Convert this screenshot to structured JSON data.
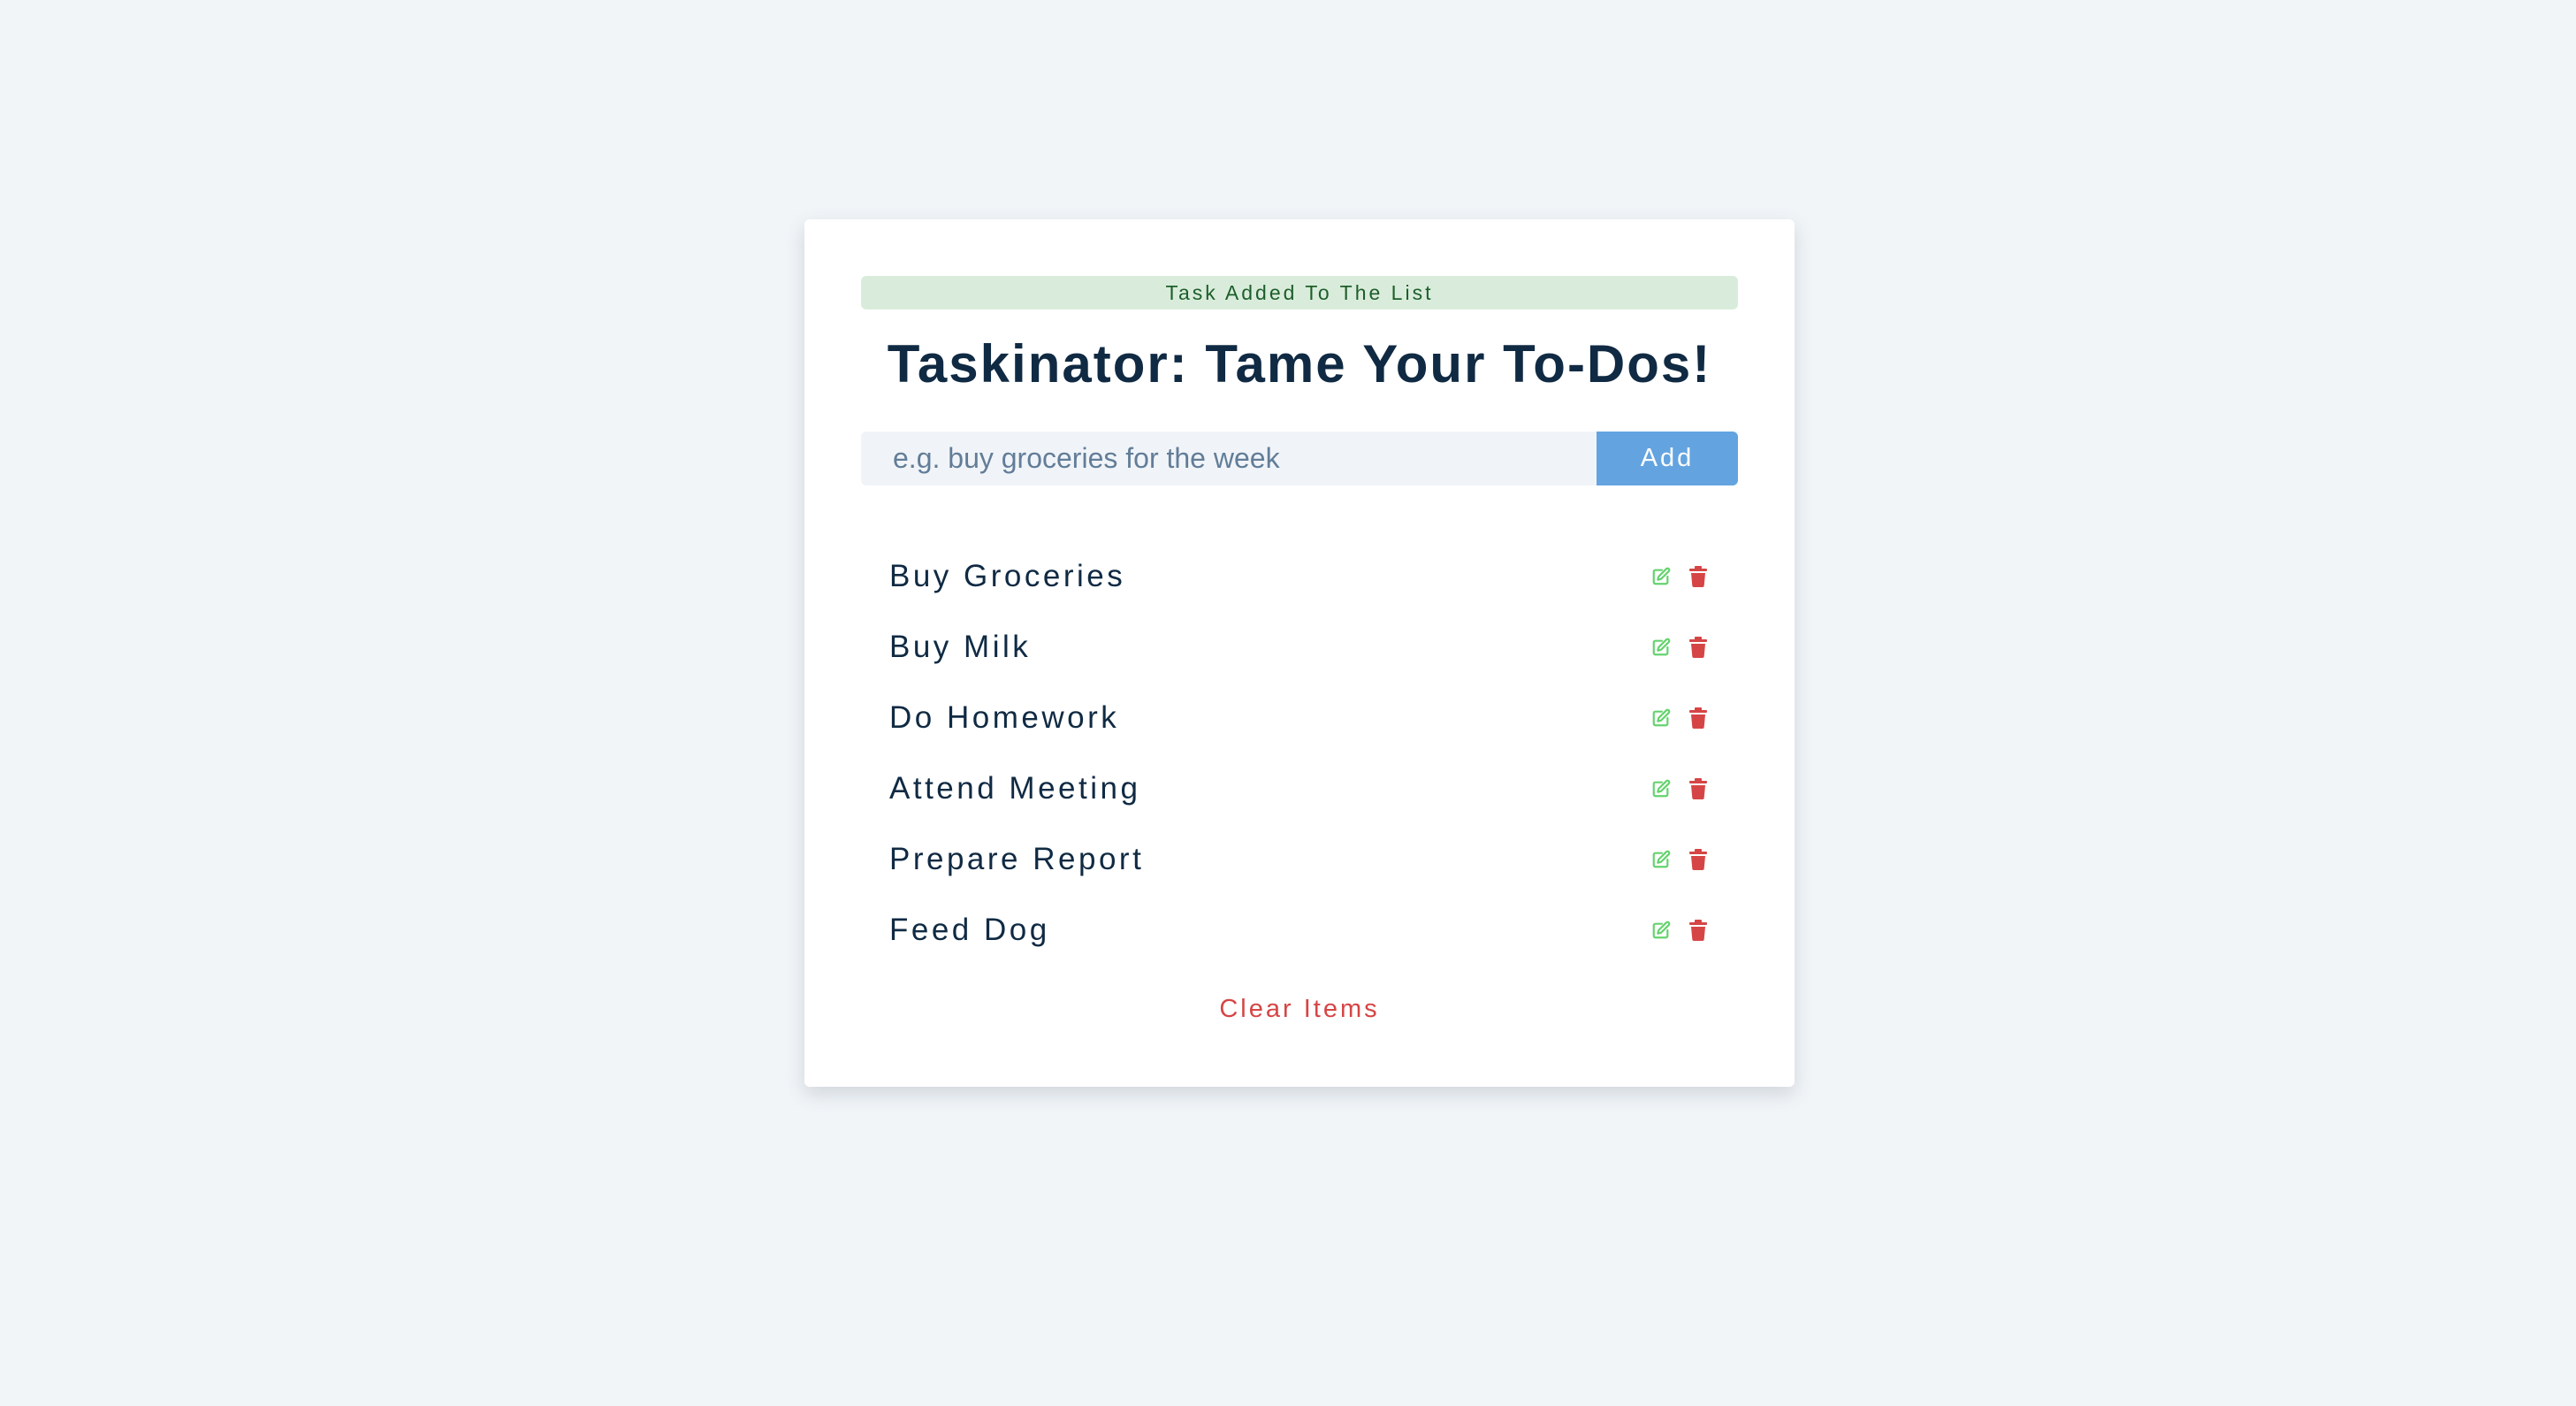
{
  "alert": {
    "text": "Task Added To The List"
  },
  "header": {
    "title": "Taskinator: Tame Your To-Dos!"
  },
  "form": {
    "placeholder": "e.g. buy groceries for the week",
    "value": "",
    "add_label": "Add"
  },
  "tasks": [
    {
      "title": "Buy Groceries",
      "edit_icon": "edit-icon",
      "delete_icon": "trash-icon"
    },
    {
      "title": "Buy Milk",
      "edit_icon": "edit-icon",
      "delete_icon": "trash-icon"
    },
    {
      "title": "Do Homework",
      "edit_icon": "edit-icon",
      "delete_icon": "trash-icon"
    },
    {
      "title": "Attend Meeting",
      "edit_icon": "edit-icon",
      "delete_icon": "trash-icon"
    },
    {
      "title": "Prepare Report",
      "edit_icon": "edit-icon",
      "delete_icon": "trash-icon"
    },
    {
      "title": "Feed Dog",
      "edit_icon": "edit-icon",
      "delete_icon": "trash-icon"
    }
  ],
  "footer": {
    "clear_label": "Clear Items"
  },
  "colors": {
    "background": "#f1f5f8",
    "card": "#ffffff",
    "alert_bg": "#d9ecdb",
    "alert_text": "#1d5e2a",
    "title": "#102a43",
    "primary": "#63a4e0",
    "edit": "#65d26e",
    "danger": "#d64545"
  }
}
